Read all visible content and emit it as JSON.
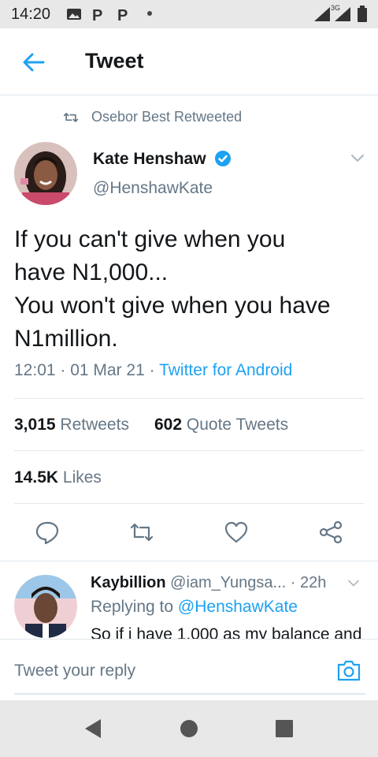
{
  "status_bar": {
    "time": "14:20",
    "network": "3G"
  },
  "header": {
    "title": "Tweet"
  },
  "tweet": {
    "retweeted_by": "Osebor Best Retweeted",
    "author_name": "Kate Henshaw",
    "author_handle": "@HenshawKate",
    "text_lines": [
      "If you can't give when you",
      "have N1,000...",
      "You won't give when you have",
      "N1million."
    ],
    "time": "12:01",
    "date": "01 Mar 21",
    "source": "Twitter for Android",
    "retweets_count": "3,015",
    "retweets_label": "Retweets",
    "quotes_count": "602",
    "quotes_label": "Quote Tweets",
    "likes_count": "14.5K",
    "likes_label": "Likes"
  },
  "reply": {
    "author_name": "Kaybillion",
    "author_handle": "@iam_Yungsa...",
    "age": "22h",
    "replying_label": "Replying to",
    "replying_handle": "@HenshawKate",
    "text": "So if i have 1,000 as my balance and"
  },
  "composer": {
    "placeholder": "Tweet your reply"
  },
  "colors": {
    "accent": "#1da1f2",
    "muted": "#657786",
    "text": "#14171a",
    "divider": "#e1e8ed"
  }
}
